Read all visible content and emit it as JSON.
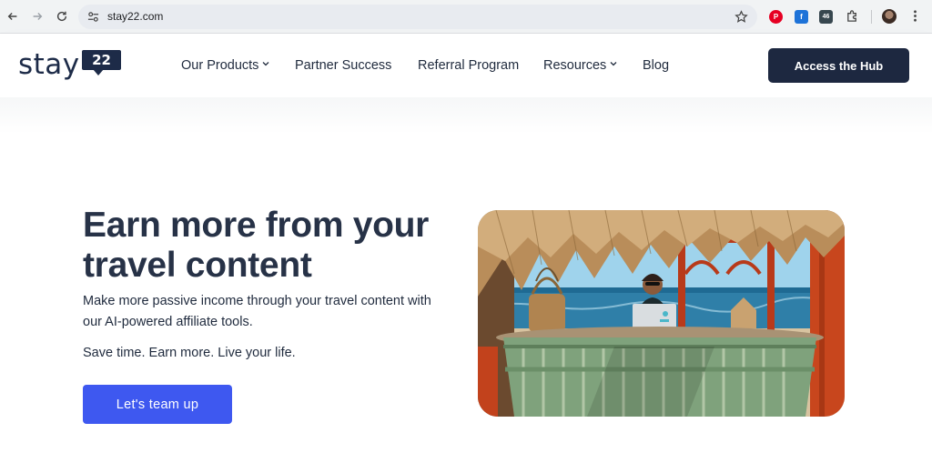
{
  "browser": {
    "url": "stay22.com",
    "extensions": [
      "pinterest-extension",
      "blue-extension",
      "counter-extension",
      "puzzle-extensions",
      "profile-avatar",
      "menu"
    ],
    "counter_badge": "46"
  },
  "header": {
    "logo_word": "stay",
    "logo_badge": "22",
    "nav": [
      {
        "label": "Our Products",
        "dropdown": true
      },
      {
        "label": "Partner Success",
        "dropdown": false
      },
      {
        "label": "Referral Program",
        "dropdown": false
      },
      {
        "label": "Resources",
        "dropdown": true
      },
      {
        "label": "Blog",
        "dropdown": false
      }
    ],
    "cta_label": "Access the Hub"
  },
  "hero": {
    "title": "Earn more from your travel content",
    "subtitle": "Make more passive income through your travel content with our AI-powered affiliate tools.",
    "tagline": "Save time. Earn more. Live your life.",
    "cta_label": "Let's team up"
  },
  "colors": {
    "navy": "#1d2840",
    "brand_blue": "#3e58f0",
    "text": "#1f2a3d"
  }
}
